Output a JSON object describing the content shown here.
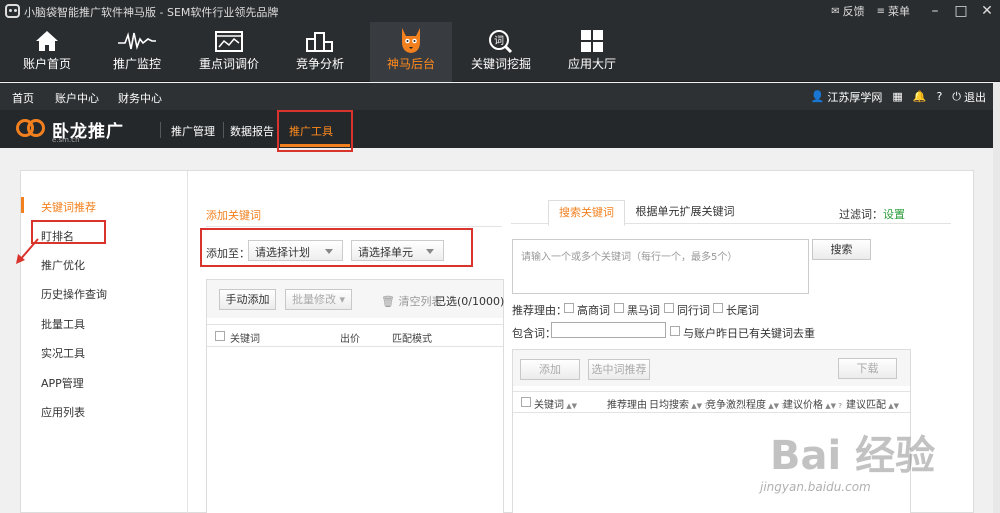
{
  "titlebar": {
    "title": "小脑袋智能推广软件神马版 - SEM软件行业领先品牌",
    "feedback": "反馈",
    "menu": "菜单"
  },
  "mainnav": [
    {
      "label": "账户首页",
      "icon": "home-icon"
    },
    {
      "label": "推广监控",
      "icon": "pulse-icon"
    },
    {
      "label": "重点词调价",
      "icon": "chart-window-icon"
    },
    {
      "label": "竞争分析",
      "icon": "podium-icon"
    },
    {
      "label": "神马后台",
      "icon": "fox-icon",
      "active": true
    },
    {
      "label": "关键词挖掘",
      "icon": "search-word-icon"
    },
    {
      "label": "应用大厅",
      "icon": "grid-icon"
    }
  ],
  "subbar": {
    "home": "首页",
    "account_center": "账户中心",
    "finance_center": "财务中心",
    "user": "江苏厚学网",
    "logout": "退出"
  },
  "brand": {
    "name": "卧龙推广",
    "sub": "e.sm.cn",
    "tabs": [
      "推广管理",
      "数据报告",
      "推广工具"
    ],
    "active_tab": "推广工具"
  },
  "sidebar": {
    "items": [
      "关键词推荐",
      "盯排名",
      "推广优化",
      "历史操作查询",
      "批量工具",
      "实况工具",
      "APP管理",
      "应用列表"
    ],
    "active": "关键词推荐"
  },
  "add_keywords": {
    "title": "添加关键词",
    "add_to_label": "添加至：",
    "plan_select": "请选择计划",
    "unit_select": "请选择单元",
    "manual_add": "手动添加",
    "batch_edit": "批量修改",
    "clear_list": "清空列表",
    "selected": "已选(0/1000)",
    "columns": [
      "关键词",
      "出价",
      "匹配模式"
    ]
  },
  "search_panel": {
    "tabs": [
      "搜索关键词",
      "根据单元扩展关键词"
    ],
    "filter_label": "过滤词：",
    "filter_link": "设置",
    "textarea_placeholder": "请输入一个或多个关键词（每行一个，最多5个）",
    "search_button": "搜索",
    "reason_label": "推荐理由：",
    "reasons": [
      "高商词",
      "黑马词",
      "同行词",
      "长尾词"
    ],
    "contains_label": "包含词：",
    "dedupe_label": "与账户昨日已有关键词去重",
    "add_button": "添加",
    "midword_button": "选中词推荐",
    "download_button": "下载",
    "columns": [
      "关键词",
      "推荐理由",
      "日均搜索",
      "竞争激烈程度",
      "建议价格",
      "建议匹配"
    ]
  },
  "watermark": {
    "text": "Bai 经验",
    "url": "jingyan.baidu.com"
  }
}
